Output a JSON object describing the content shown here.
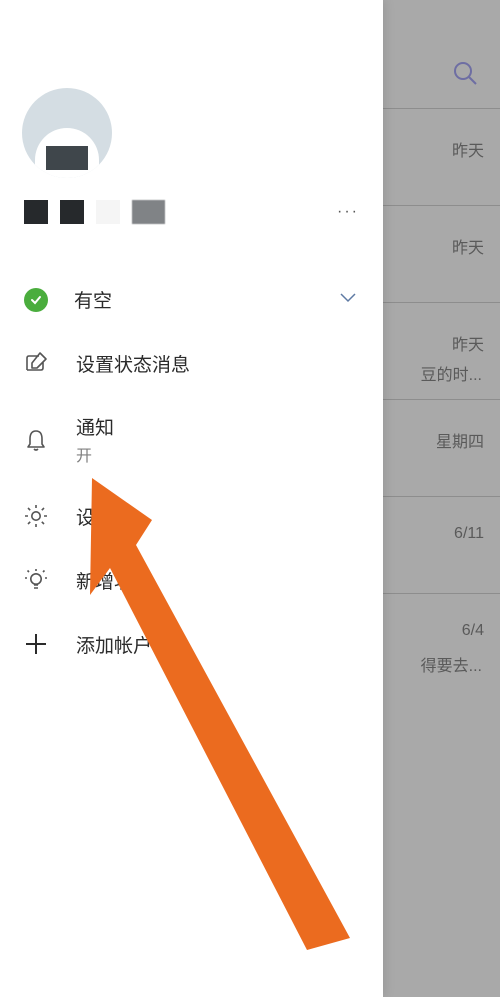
{
  "profile": {
    "more_dots": "···"
  },
  "status": {
    "label": "有空"
  },
  "menu": {
    "status_message": "设置状态消息",
    "notifications": "通知",
    "notifications_state": "开",
    "settings": "设置",
    "whats_new": "新增功能",
    "add_account": "添加帐户"
  },
  "background": {
    "items": [
      {
        "time": "昨天",
        "sub": ""
      },
      {
        "time": "昨天",
        "sub": ""
      },
      {
        "time": "昨天",
        "sub": "豆的时..."
      },
      {
        "time": "星期四",
        "sub": ""
      },
      {
        "time": "6/11",
        "sub": ""
      },
      {
        "time": "6/4",
        "sub": "得要去..."
      }
    ]
  }
}
